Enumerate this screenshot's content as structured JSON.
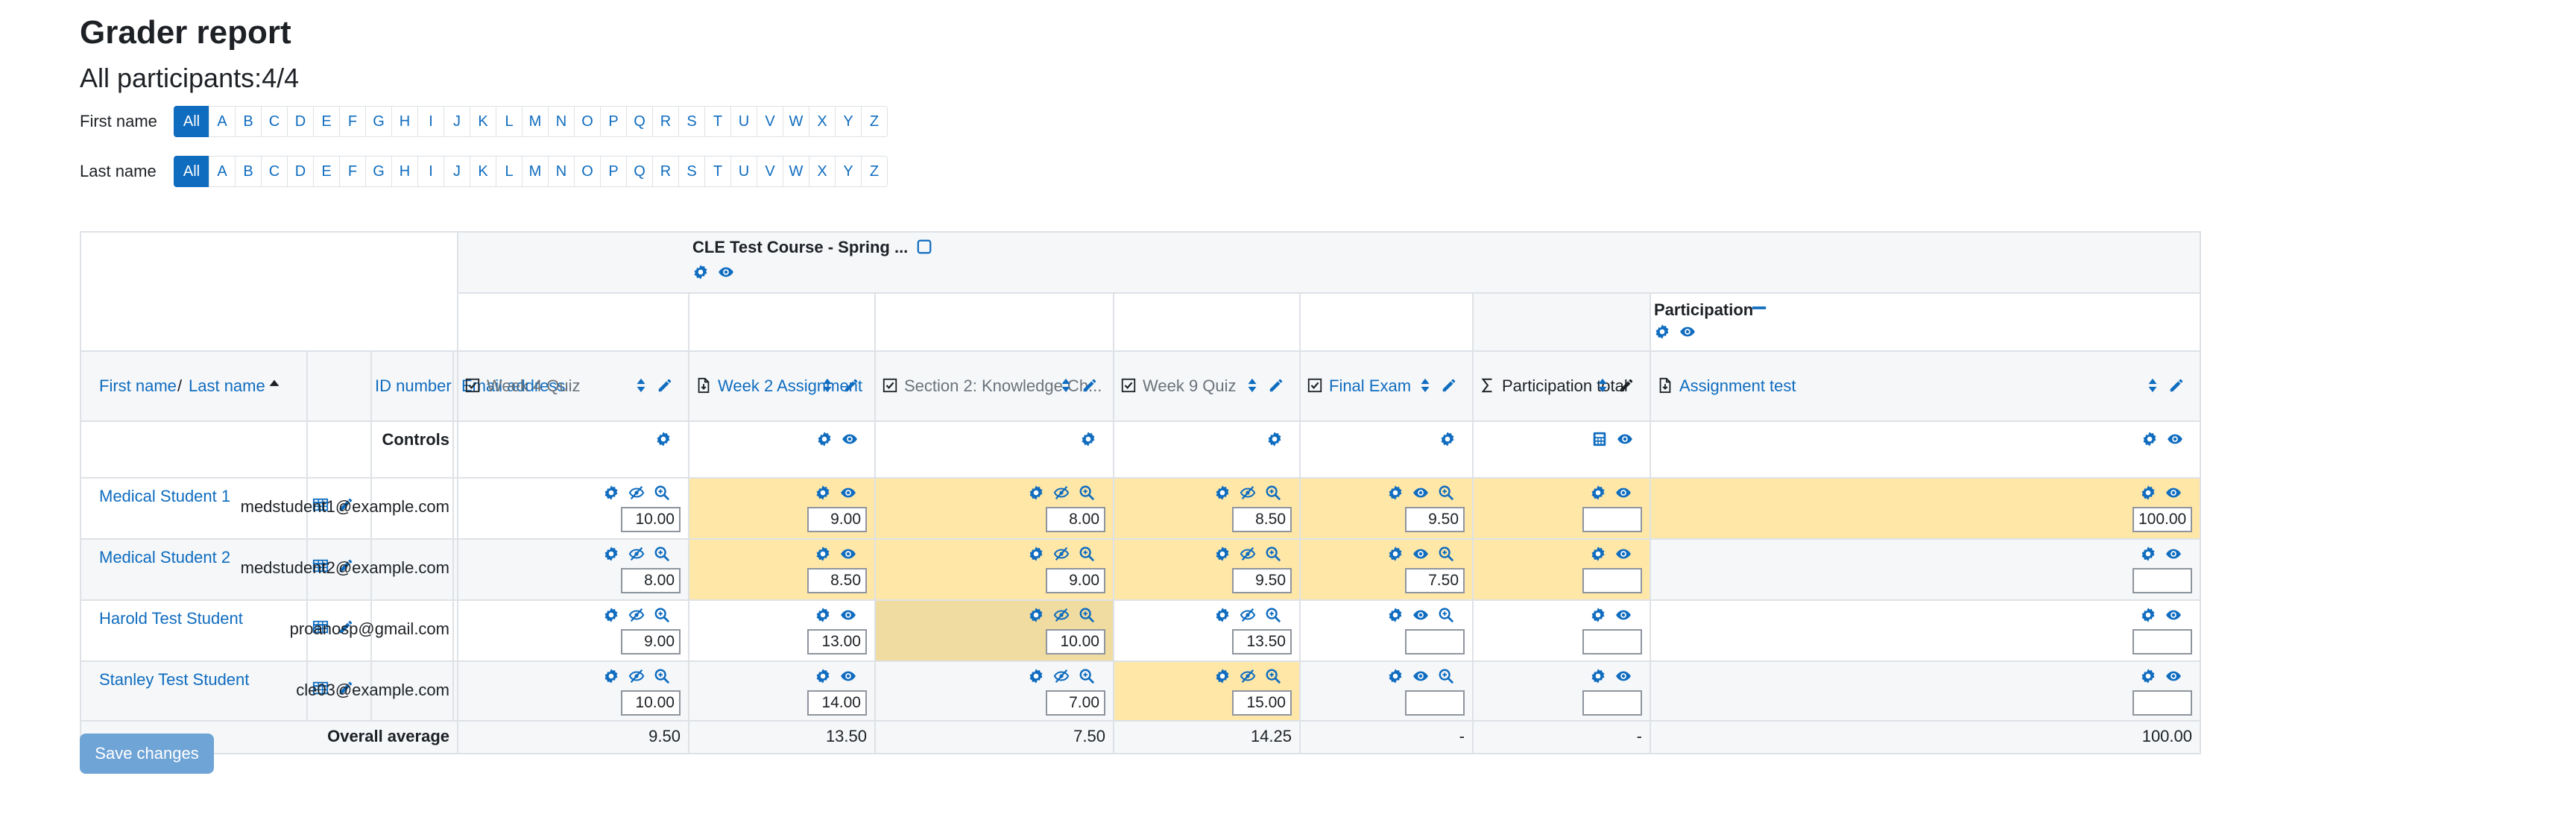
{
  "page": {
    "title": "Grader report",
    "participants": "All participants:4/4",
    "first_name_label": "First name",
    "last_name_label": "Last name",
    "letters": [
      "All",
      "A",
      "B",
      "C",
      "D",
      "E",
      "F",
      "G",
      "H",
      "I",
      "J",
      "K",
      "L",
      "M",
      "N",
      "O",
      "P",
      "Q",
      "R",
      "S",
      "T",
      "U",
      "V",
      "W",
      "X",
      "Y",
      "Z"
    ],
    "save_label": "Save changes"
  },
  "report": {
    "course_name": "CLE Test Course - Spring ...",
    "category_name": "Participation",
    "header_first": "First name",
    "header_sep": "/",
    "header_last": "Last name",
    "header_id": "ID number",
    "header_email": "Email address",
    "controls_label": "Controls",
    "average_label": "Overall average",
    "items": [
      {
        "name": "Week 4 Quiz",
        "muted": true,
        "icon": "quiz-icon"
      },
      {
        "name": "Week 2 Assignment",
        "muted": false,
        "icon": "assignment-icon"
      },
      {
        "name": "Section 2: Knowledge Ch...",
        "muted": true,
        "icon": "quiz-icon"
      },
      {
        "name": "Week 9 Quiz",
        "muted": true,
        "icon": "quiz-icon"
      },
      {
        "name": "Final Exam",
        "muted": false,
        "icon": "quiz-icon"
      },
      {
        "name": "Participation total",
        "muted": false,
        "dark": true,
        "icon": "sigma-icon"
      },
      {
        "name": "Assignment test",
        "muted": false,
        "icon": "assignment-icon"
      }
    ],
    "students": [
      {
        "name": "Medical Student 1",
        "email": "medstudent1@example.com",
        "grades": [
          "10.00",
          "9.00",
          "8.00",
          "8.50",
          "9.50",
          "",
          "100.00"
        ]
      },
      {
        "name": "Medical Student 2",
        "email": "medstudent2@example.com",
        "grades": [
          "8.00",
          "8.50",
          "9.00",
          "9.50",
          "7.50",
          "",
          ""
        ]
      },
      {
        "name": "Harold Test Student",
        "email": "proanosp@gmail.com",
        "grades": [
          "9.00",
          "13.00",
          "10.00",
          "13.50",
          "",
          "",
          ""
        ]
      },
      {
        "name": "Stanley Test Student",
        "email": "cle03@example.com",
        "grades": [
          "10.00",
          "14.00",
          "7.00",
          "15.00",
          "",
          "",
          ""
        ]
      }
    ],
    "averages": [
      "9.50",
      "13.50",
      "7.50",
      "14.25",
      "-",
      "-",
      "100.00"
    ],
    "colors": {
      "overridden": "#ffe7a8",
      "overridden_dark": "#f0dca0",
      "header_bg": "#f5f7f9",
      "link": "#0f6cbf"
    }
  }
}
